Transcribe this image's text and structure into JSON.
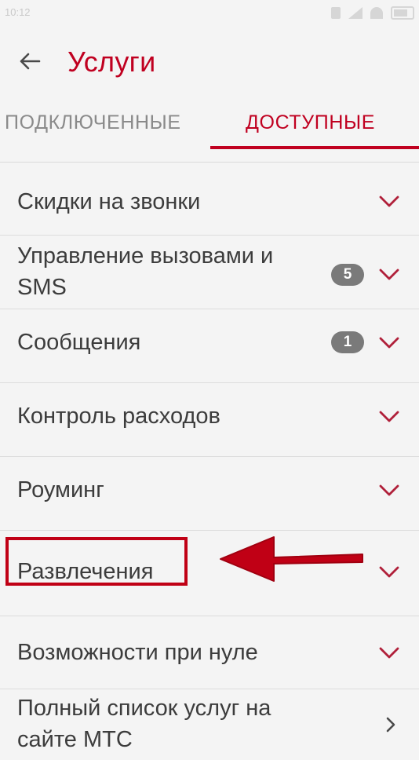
{
  "status_bar": {
    "time": "10:12",
    "icons": [
      "sim-icon",
      "signal-icon",
      "wifi-icon",
      "battery-icon"
    ]
  },
  "app_bar": {
    "back_icon": "arrow-left-icon",
    "title": "Услуги"
  },
  "tabs": [
    {
      "label": "ПОДКЛЮЧЕННЫЕ",
      "active": false
    },
    {
      "label": "ДОСТУПНЫЕ",
      "active": true
    }
  ],
  "services": [
    {
      "label": "Скидки на звонки",
      "badge": null,
      "icon": "chevron-down-icon"
    },
    {
      "label_line1": "Управление вызовами и",
      "label_line2": "SMS",
      "badge": "5",
      "icon": "chevron-down-icon"
    },
    {
      "label": "Сообщения",
      "badge": "1",
      "icon": "chevron-down-icon"
    },
    {
      "label": "Контроль расходов",
      "badge": null,
      "icon": "chevron-down-icon"
    },
    {
      "label": "Роуминг",
      "badge": null,
      "icon": "chevron-down-icon"
    },
    {
      "label": "Развлечения",
      "badge": null,
      "icon": "chevron-down-icon",
      "highlighted": true
    },
    {
      "label": "Возможности при нуле",
      "badge": null,
      "icon": "chevron-down-icon"
    },
    {
      "label_line1": "Полный список услуг на",
      "label_line2": "сайте МТС",
      "badge": null,
      "icon": "chevron-right-icon"
    }
  ],
  "colors": {
    "accent": "#c00020",
    "text": "#3c3c3c",
    "tab_inactive": "#8a8a8a",
    "badge": "#7a7a7a",
    "annotation": "#c00015",
    "background": "#f4f4f4"
  }
}
